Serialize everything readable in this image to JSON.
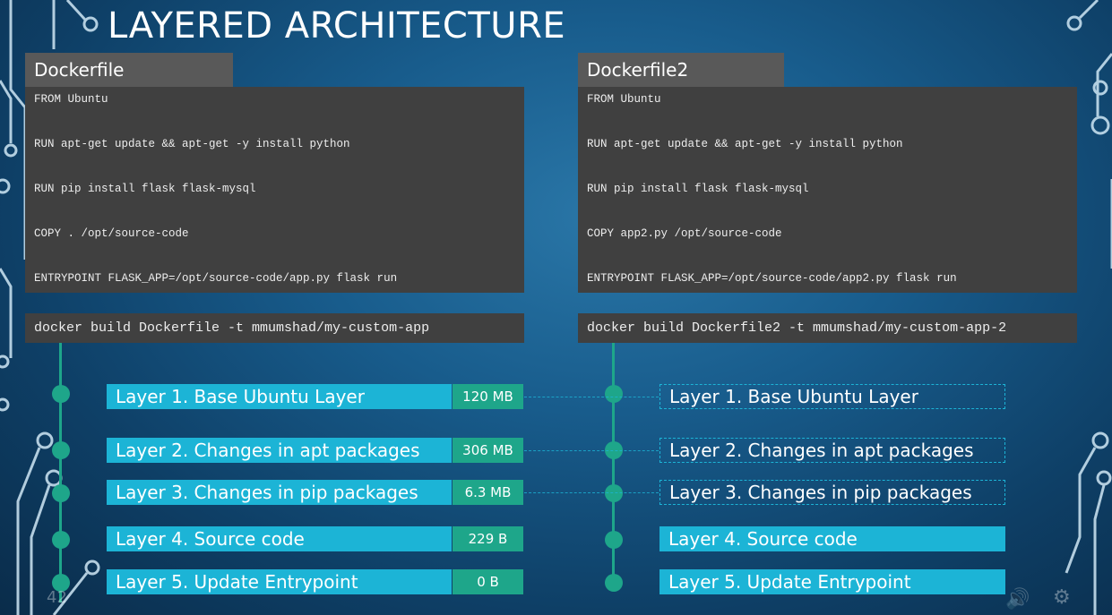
{
  "slide": {
    "title": "LAYERED ARCHITECTURE"
  },
  "left": {
    "header": "Dockerfile",
    "lines": [
      "FROM Ubuntu",
      "RUN apt-get update && apt-get -y install python",
      "RUN pip install flask flask-mysql",
      "COPY . /opt/source-code",
      "ENTRYPOINT FLASK_APP=/opt/source-code/app.py flask run"
    ],
    "build_command": "docker build Dockerfile -t mmumshad/my-custom-app",
    "layers": [
      {
        "label": "Layer 1. Base Ubuntu Layer",
        "size": "120 MB"
      },
      {
        "label": "Layer 2. Changes in apt packages",
        "size": "306 MB"
      },
      {
        "label": "Layer 3. Changes in pip packages",
        "size": "6.3 MB"
      },
      {
        "label": "Layer 4. Source code",
        "size": "229 B"
      },
      {
        "label": "Layer 5. Update Entrypoint",
        "size": "0 B"
      }
    ]
  },
  "right": {
    "header": "Dockerfile2",
    "lines": [
      "FROM Ubuntu",
      "RUN apt-get update && apt-get -y install python",
      "RUN pip install flask flask-mysql",
      "COPY app2.py /opt/source-code",
      "ENTRYPOINT FLASK_APP=/opt/source-code/app2.py flask run"
    ],
    "build_command": "docker build Dockerfile2 -t mmumshad/my-custom-app-2",
    "layers": [
      {
        "label": "Layer 1. Base Ubuntu Layer",
        "style": "cached-dashed"
      },
      {
        "label": "Layer 2. Changes in apt packages",
        "style": "cached-dashed"
      },
      {
        "label": "Layer 3. Changes in pip packages",
        "style": "cached-dashed"
      },
      {
        "label": "Layer 4. Source code",
        "style": "new-solid"
      },
      {
        "label": "Layer 5. Update Entrypoint",
        "style": "new-solid"
      }
    ]
  },
  "player": {
    "time": "42"
  },
  "colors": {
    "layer_fill": "#1cb4d6",
    "size_fill": "#1ea68a",
    "code_bg": "#404040",
    "header_bg": "#595959"
  }
}
